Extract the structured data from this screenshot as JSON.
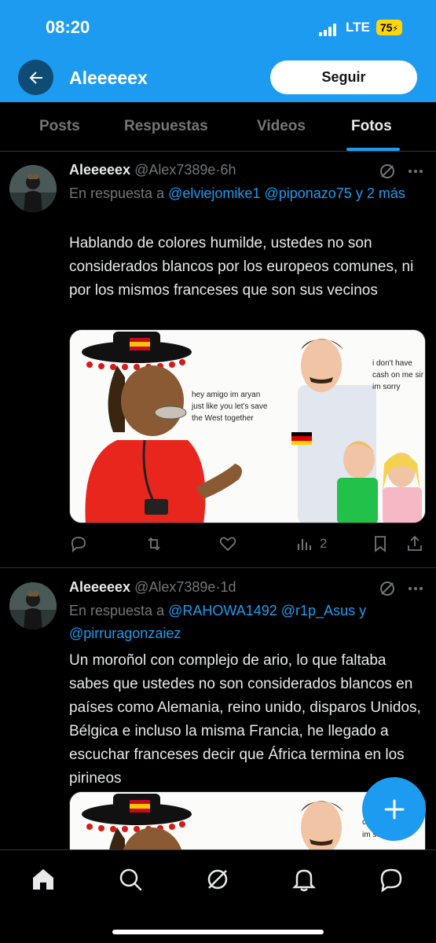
{
  "status_bar": {
    "time": "08:20",
    "network": "LTE",
    "battery": "75"
  },
  "header": {
    "title": "Aleeeeex",
    "follow_label": "Seguir"
  },
  "tabs": [
    {
      "label": "Posts"
    },
    {
      "label": "Respuestas"
    },
    {
      "label": "Videos"
    },
    {
      "label": "Fotos"
    }
  ],
  "active_tab": "Fotos",
  "tweets": [
    {
      "name": "Aleeeeex",
      "handle": "@Alex7389e",
      "sep": "·",
      "time": "6h",
      "reply_prefix": "En respuesta a",
      "reply_mention_1": "@elviejomike1",
      "reply_mention_2": "@piponazo75",
      "reply_suffix": "y 2 más",
      "text": "Hablando de colores humilde, ustedes no son considerados blancos por los europeos comunes, ni por los mismos franceses que son sus vecinos",
      "image": {
        "left_bubble": "hey amigo im aryan just like you let's save the West together",
        "right_bubble": "i don't have cash on me sir im sorry"
      },
      "views": "2"
    },
    {
      "name": "Aleeeeex",
      "handle": "@Alex7389e",
      "sep": "·",
      "time": "1d",
      "reply_prefix": "En respuesta a",
      "reply_mention_1": "@RAHOWA1492",
      "reply_mention_2": "@r1p_Asus",
      "reply_joiner": "y",
      "reply_mention_3": "@pirruragonzaiez",
      "text": "Un moroñol con complejo de ario, lo que faltaba sabes que ustedes no son considerados blancos en países como Alemania, reino unido, disparos Unidos, Bélgica e incluso la misma Francia, he llegado a escuchar franceses decir que África termina en los pirineos",
      "image": {
        "right_bubble_partial": "i d cas im sorry"
      }
    }
  ],
  "colors": {
    "accent": "#1d9bf0",
    "background": "#000000",
    "text": "#e7e9ea",
    "muted": "#71767b"
  },
  "icons": [
    "back-arrow-icon",
    "grok-icon",
    "more-icon",
    "reply-icon",
    "retweet-icon",
    "like-icon",
    "views-icon",
    "bookmark-icon",
    "share-icon",
    "compose-plus-icon",
    "home-icon",
    "search-icon",
    "notifications-icon",
    "messages-icon"
  ]
}
